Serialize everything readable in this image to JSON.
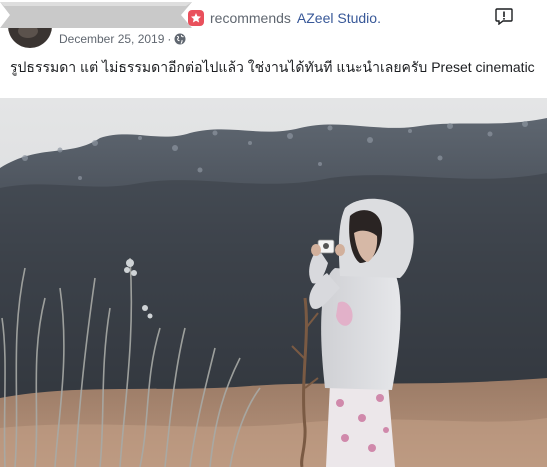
{
  "post": {
    "recommend_verb": "recommends",
    "page_name": "AZeel Studio.",
    "date": "December 25, 2019",
    "separator": "·",
    "audience_icon": "globe-icon",
    "report_icon": "exclamation-bubble-icon",
    "recommend_icon": "recommendation-star-icon",
    "text": "รูปธรรมดา แต่ ไม่ธรรมดาอีกต่อไปแล้ว ใช่งานได้ทันที แนะนำเลยครับ Preset cinematic",
    "photo_subject": "photo",
    "colors": {
      "link": "#385898",
      "muted": "#606770",
      "recommend_badge": "#e9505c"
    }
  }
}
